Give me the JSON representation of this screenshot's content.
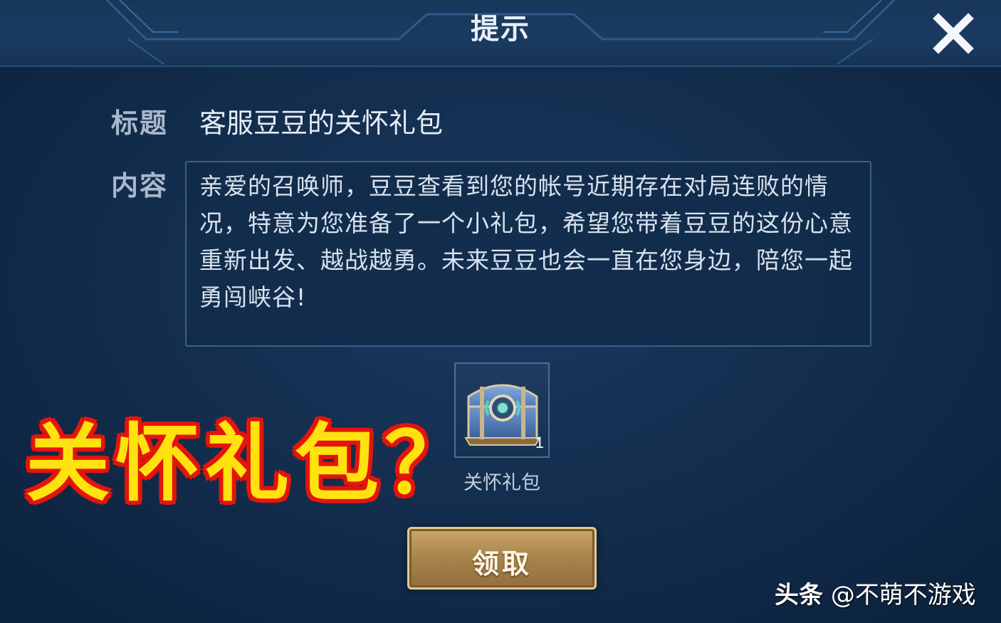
{
  "dialog": {
    "title": "提示",
    "close_icon": "close-icon"
  },
  "mail": {
    "subject_label": "标题",
    "subject": "客服豆豆的关怀礼包",
    "content_label": "内容",
    "content": "亲爱的召唤师，豆豆查看到您的帐号近期存在对局连败的情况，特意为您准备了一个小礼包，希望您带着豆豆的这份心意重新出发、越战越勇。未来豆豆也会一直在您身边，陪您一起勇闯峡谷!"
  },
  "reward": {
    "icon": "treasure-chest-icon",
    "count": "1",
    "name": "关怀礼包"
  },
  "overlay_caption": "关怀礼包？",
  "claim_button": {
    "label": "领取"
  },
  "watermark": {
    "brand": "头条",
    "account": "@不萌不游戏"
  },
  "colors": {
    "background": "#142f50",
    "overlay_text": "#ffe20f",
    "overlay_outline": "#e3150a",
    "button_gold": "#a8834b"
  }
}
